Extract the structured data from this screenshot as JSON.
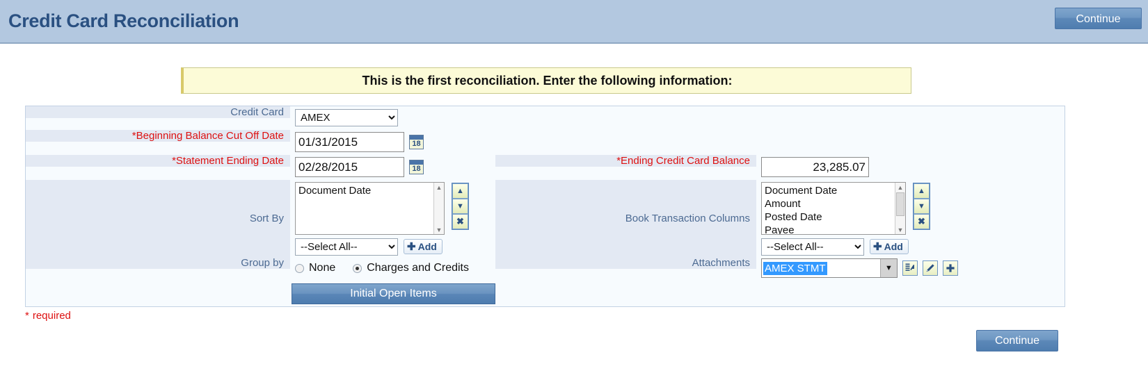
{
  "header": {
    "title": "Credit Card Reconciliation",
    "continue_label": "Continue"
  },
  "banner": {
    "message": "This is the first reconciliation. Enter the following information:"
  },
  "form": {
    "credit_card": {
      "label": "Credit Card",
      "value": "AMEX",
      "options": [
        "AMEX"
      ]
    },
    "beginning_balance_cut_off_date": {
      "label": "*Beginning Balance Cut Off Date",
      "value": "01/31/2015",
      "calendar_icon_day": "18"
    },
    "statement_ending_date": {
      "label": "*Statement Ending Date",
      "value": "02/28/2015",
      "calendar_icon_day": "18"
    },
    "sort_by": {
      "label": "Sort By",
      "items": [
        "Document Date"
      ],
      "select_all_value": "--Select All--",
      "add_label": "Add"
    },
    "group_by": {
      "label": "Group by",
      "options": [
        "None",
        "Charges and Credits"
      ],
      "selected": "Charges and Credits"
    },
    "initial_open_items": {
      "label": "Initial Open Items"
    },
    "ending_credit_card_balance": {
      "label": "*Ending Credit Card Balance",
      "value": "23,285.07"
    },
    "book_transaction_columns": {
      "label": "Book Transaction Columns",
      "items": [
        "Document Date",
        "Amount",
        "Posted Date",
        "Payee"
      ],
      "select_all_value": "--Select All--",
      "add_label": "Add"
    },
    "attachments": {
      "label": "Attachments",
      "value": "AMEX STMT"
    }
  },
  "footer": {
    "required_star": "*",
    "required_text": "required",
    "continue_label": "Continue"
  },
  "glyphs": {
    "up_arrow": "▲",
    "down_arrow": "▼",
    "close_x": "✖",
    "plus": "✚",
    "pencil": "✎",
    "dropdown_caret": "▼"
  },
  "colors": {
    "header_bg": "#b3c8e0",
    "title_blue": "#2a5081",
    "required_red": "#dd1111",
    "banner_bg": "#fcfbd7",
    "label_blue": "#4c6a92",
    "selection_blue": "#3399ff"
  }
}
